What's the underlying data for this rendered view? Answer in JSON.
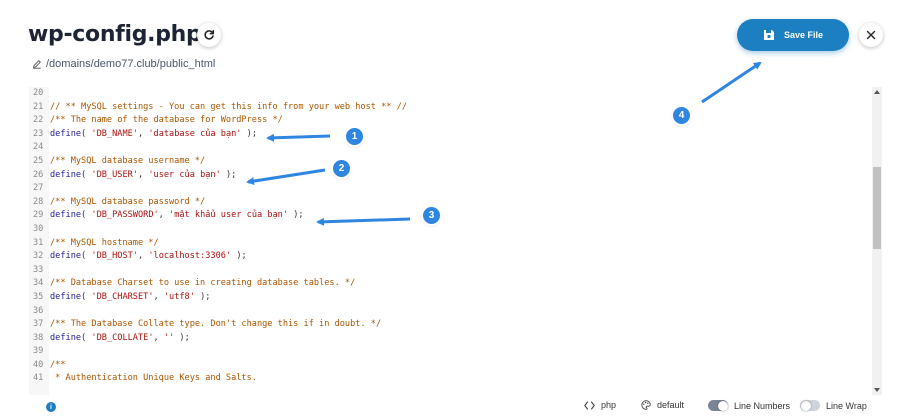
{
  "header": {
    "title": "wp-config.php",
    "path": "/domains/demo77.club/public_html",
    "save_label": "Save File"
  },
  "editor": {
    "lines": [
      {
        "n": "20",
        "parts": []
      },
      {
        "n": "21",
        "parts": [
          {
            "t": "// ** MySQL settings - You can get this info from your web host ** //",
            "c": "comment"
          }
        ]
      },
      {
        "n": "22",
        "parts": [
          {
            "t": "/** The name of the database for WordPress */",
            "c": "comment"
          }
        ]
      },
      {
        "n": "23",
        "parts": [
          {
            "t": "define",
            "c": "kw"
          },
          {
            "t": "( ",
            "c": "plain"
          },
          {
            "t": "'DB_NAME'",
            "c": "str"
          },
          {
            "t": ", ",
            "c": "plain"
          },
          {
            "t": "'database của bạn'",
            "c": "str"
          },
          {
            "t": " );",
            "c": "plain"
          }
        ]
      },
      {
        "n": "24",
        "parts": []
      },
      {
        "n": "25",
        "parts": [
          {
            "t": "/** MySQL database username */",
            "c": "comment"
          }
        ]
      },
      {
        "n": "26",
        "parts": [
          {
            "t": "define",
            "c": "kw"
          },
          {
            "t": "( ",
            "c": "plain"
          },
          {
            "t": "'DB_USER'",
            "c": "str"
          },
          {
            "t": ", ",
            "c": "plain"
          },
          {
            "t": "'user của bạn'",
            "c": "str"
          },
          {
            "t": " );",
            "c": "plain"
          }
        ]
      },
      {
        "n": "27",
        "parts": []
      },
      {
        "n": "28",
        "parts": [
          {
            "t": "/** MySQL database password */",
            "c": "comment"
          }
        ]
      },
      {
        "n": "29",
        "parts": [
          {
            "t": "define",
            "c": "kw"
          },
          {
            "t": "( ",
            "c": "plain"
          },
          {
            "t": "'DB_PASSWORD'",
            "c": "str"
          },
          {
            "t": ", ",
            "c": "plain"
          },
          {
            "t": "'mật khẩu user của bạn'",
            "c": "str"
          },
          {
            "t": " );",
            "c": "plain"
          }
        ]
      },
      {
        "n": "30",
        "parts": []
      },
      {
        "n": "31",
        "parts": [
          {
            "t": "/** MySQL hostname */",
            "c": "comment"
          }
        ]
      },
      {
        "n": "32",
        "parts": [
          {
            "t": "define",
            "c": "kw"
          },
          {
            "t": "( ",
            "c": "plain"
          },
          {
            "t": "'DB_HOST'",
            "c": "str"
          },
          {
            "t": ", ",
            "c": "plain"
          },
          {
            "t": "'localhost:3306'",
            "c": "str"
          },
          {
            "t": " );",
            "c": "plain"
          }
        ]
      },
      {
        "n": "33",
        "parts": []
      },
      {
        "n": "34",
        "parts": [
          {
            "t": "/** Database Charset to use in creating database tables. */",
            "c": "comment"
          }
        ]
      },
      {
        "n": "35",
        "parts": [
          {
            "t": "define",
            "c": "kw"
          },
          {
            "t": "( ",
            "c": "plain"
          },
          {
            "t": "'DB_CHARSET'",
            "c": "str"
          },
          {
            "t": ", ",
            "c": "plain"
          },
          {
            "t": "'utf8'",
            "c": "str"
          },
          {
            "t": " );",
            "c": "plain"
          }
        ]
      },
      {
        "n": "36",
        "parts": []
      },
      {
        "n": "37",
        "parts": [
          {
            "t": "/** The Database Collate type. Don't change this if in doubt. */",
            "c": "comment"
          }
        ]
      },
      {
        "n": "38",
        "parts": [
          {
            "t": "define",
            "c": "kw"
          },
          {
            "t": "( ",
            "c": "plain"
          },
          {
            "t": "'DB_COLLATE'",
            "c": "str"
          },
          {
            "t": ", ",
            "c": "plain"
          },
          {
            "t": "''",
            "c": "str"
          },
          {
            "t": " );",
            "c": "plain"
          }
        ]
      },
      {
        "n": "39",
        "parts": []
      },
      {
        "n": "40",
        "parts": [
          {
            "t": "/**",
            "c": "comment"
          }
        ]
      },
      {
        "n": "41",
        "parts": [
          {
            "t": " * Authentication Unique Keys and Salts.",
            "c": "comment"
          }
        ]
      }
    ]
  },
  "footer": {
    "language": "php",
    "theme": "default",
    "line_numbers_label": "Line Numbers",
    "line_numbers_on": true,
    "line_wrap_label": "Line Wrap",
    "line_wrap_on": false
  },
  "annotations": [
    "1",
    "2",
    "3",
    "4"
  ],
  "colors": {
    "accent": "#1b7fc1",
    "annotation": "#2f86e0"
  }
}
